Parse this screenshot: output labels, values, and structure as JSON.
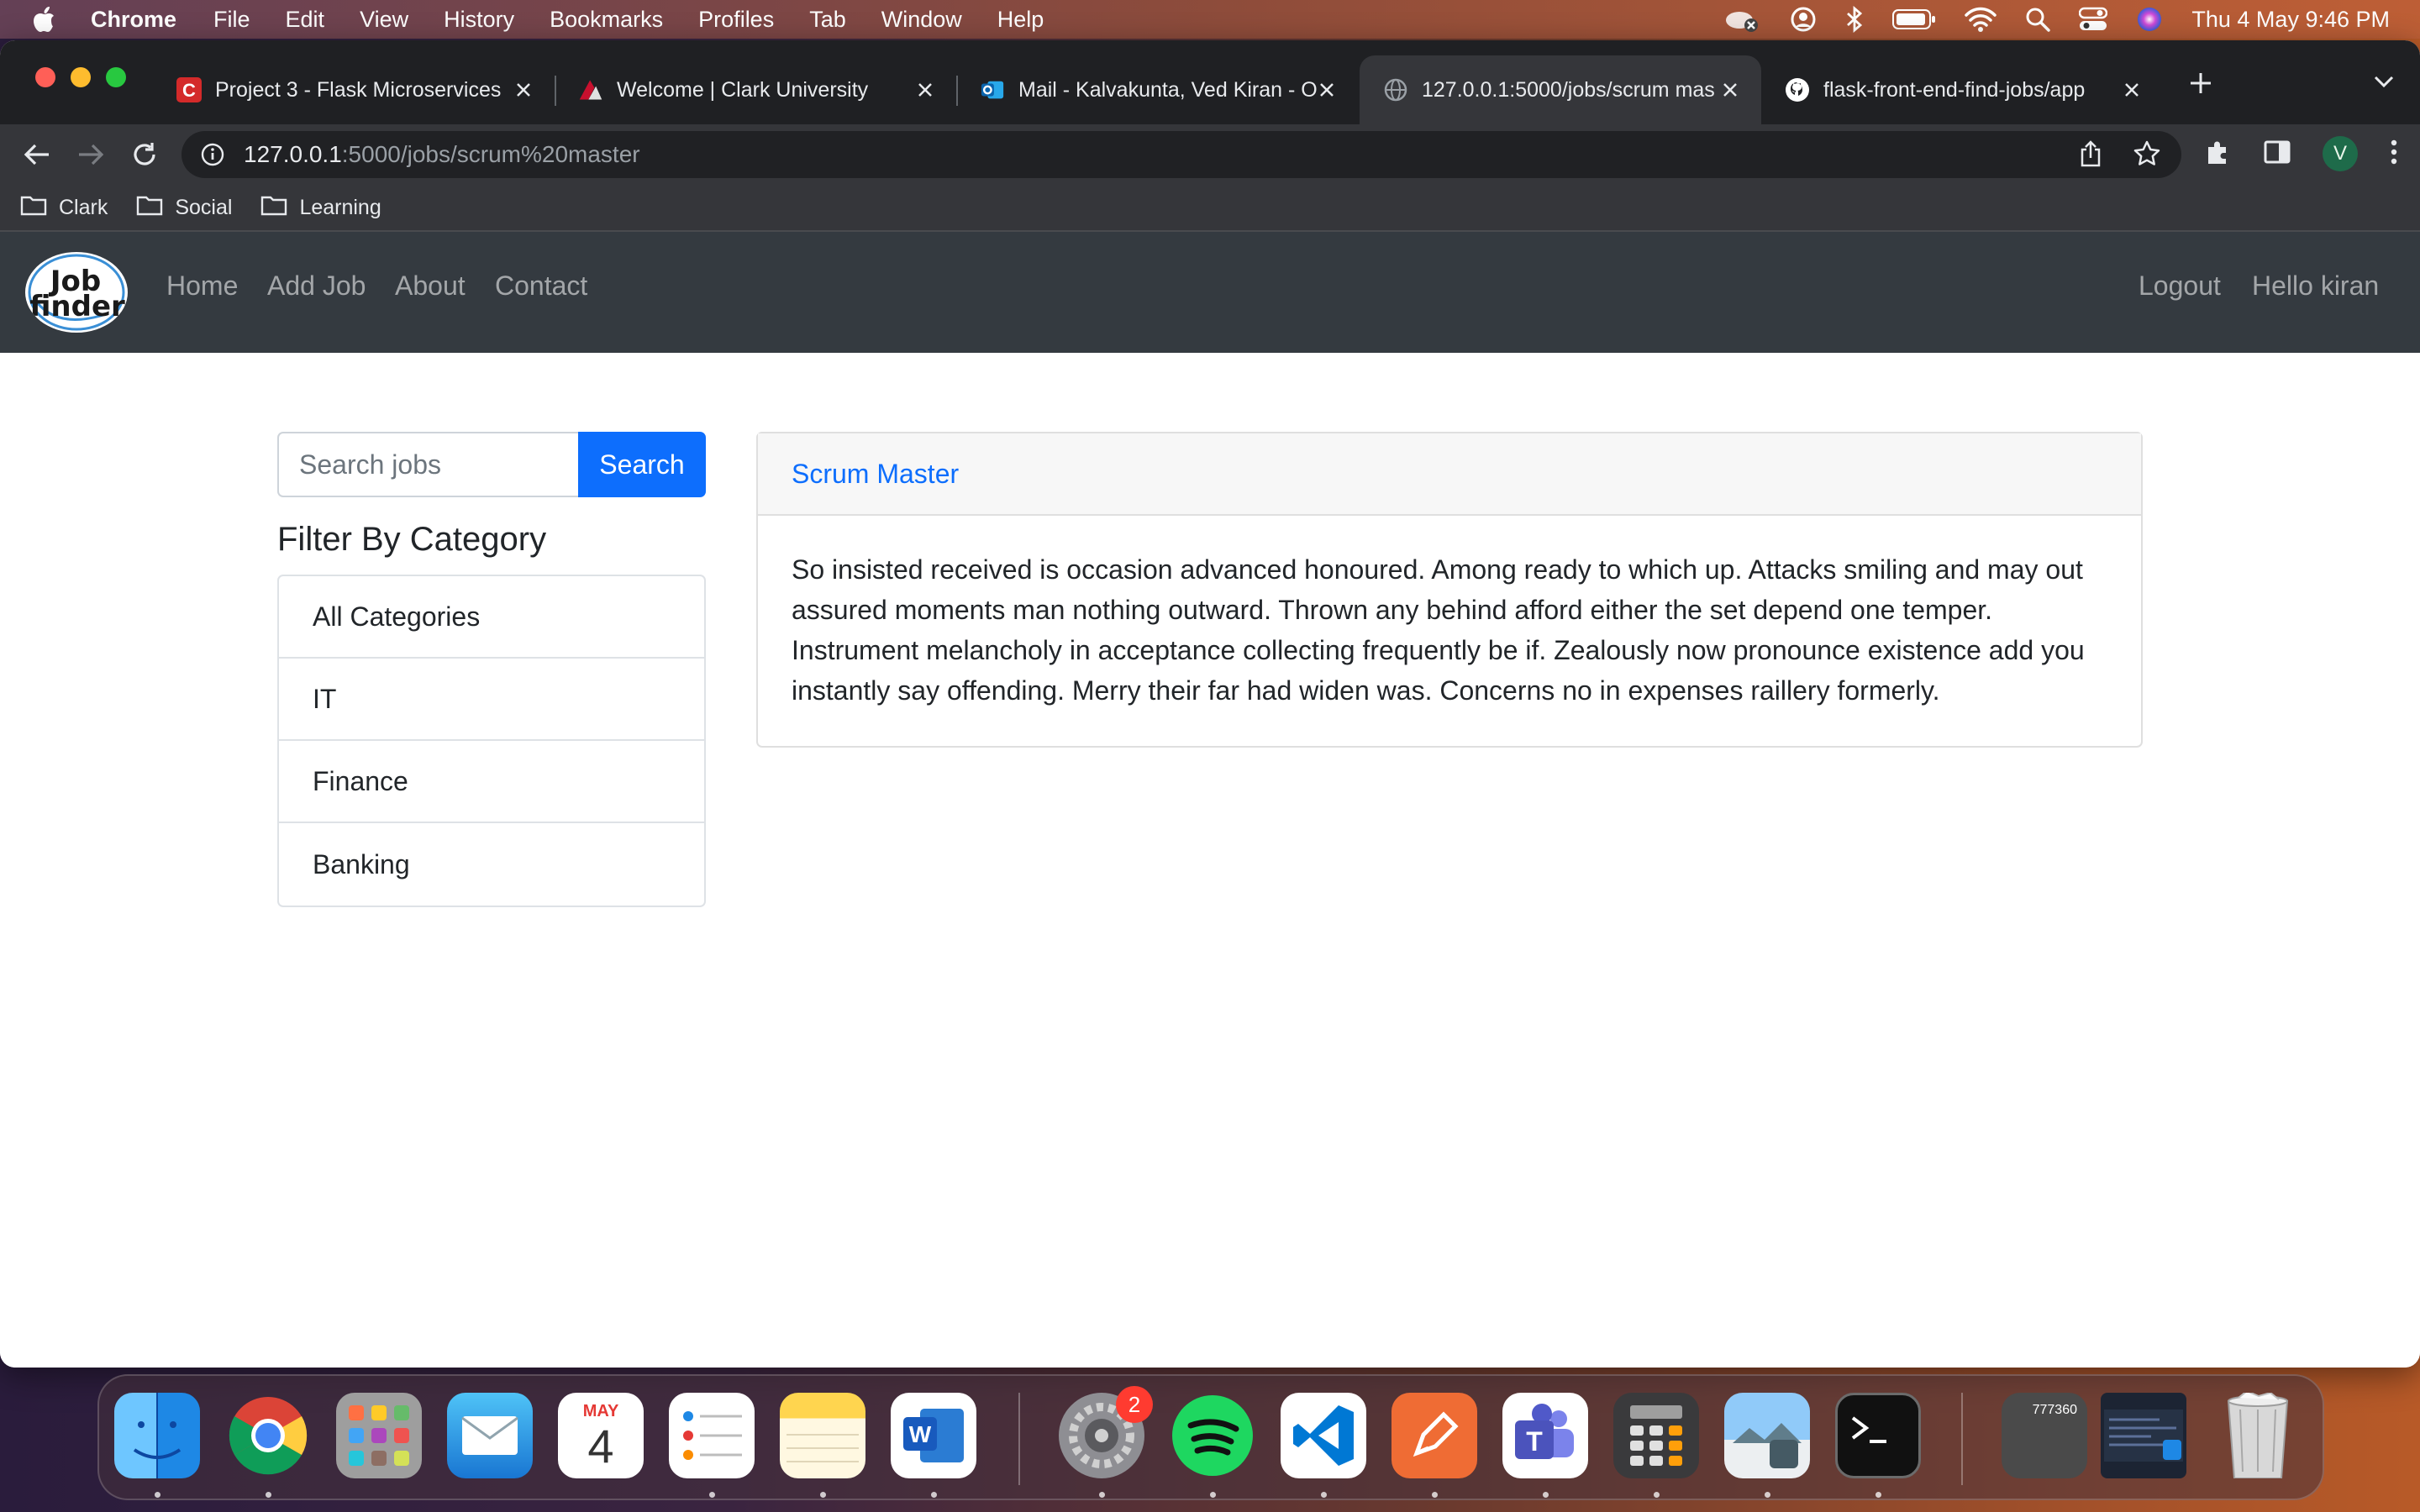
{
  "menubar": {
    "app": "Chrome",
    "items": [
      "File",
      "Edit",
      "View",
      "History",
      "Bookmarks",
      "Profiles",
      "Tab",
      "Window",
      "Help"
    ],
    "clock": "Thu 4 May  9:46 PM"
  },
  "tabs": [
    {
      "label": "Project 3 - Flask Microservices",
      "icon": "canvas-icon"
    },
    {
      "label": "Welcome | Clark University",
      "icon": "clark-icon"
    },
    {
      "label": "Mail - Kalvakunta, Ved Kiran - O",
      "icon": "outlook-icon"
    },
    {
      "label": "127.0.0.1:5000/jobs/scrum mas",
      "icon": "globe-icon"
    },
    {
      "label": "flask-front-end-find-jobs/app",
      "icon": "github-icon"
    }
  ],
  "address": {
    "host": "127.0.0.1",
    "path": ":5000/jobs/scrum%20master"
  },
  "profile_initial": "V",
  "bookmarks": [
    "Clark",
    "Social",
    "Learning"
  ],
  "site": {
    "logo_text": "Job finder",
    "nav": [
      "Home",
      "Add Job",
      "About",
      "Contact"
    ],
    "logout": "Logout",
    "greeting": "Hello kiran"
  },
  "search": {
    "placeholder": "Search jobs",
    "button": "Search"
  },
  "filter": {
    "title": "Filter By Category",
    "categories": [
      "All Categories",
      "IT",
      "Finance",
      "Banking"
    ]
  },
  "job": {
    "title": "Scrum Master",
    "description": "So insisted received is occasion advanced honoured. Among ready to which up. Attacks smiling and may out assured moments man nothing outward. Thrown any behind afford either the set depend one temper. Instrument melancholy in acceptance collecting frequently be if. Zealously now pronounce existence add you instantly say offending. Merry their far had widen was. Concerns no in expenses raillery formerly."
  },
  "dock": {
    "calendar_month": "MAY",
    "calendar_day": "4",
    "settings_badge": "2",
    "calculator_readout": "777360"
  },
  "colors": {
    "primary": "#0d6efd",
    "navbar": "#343a40"
  }
}
